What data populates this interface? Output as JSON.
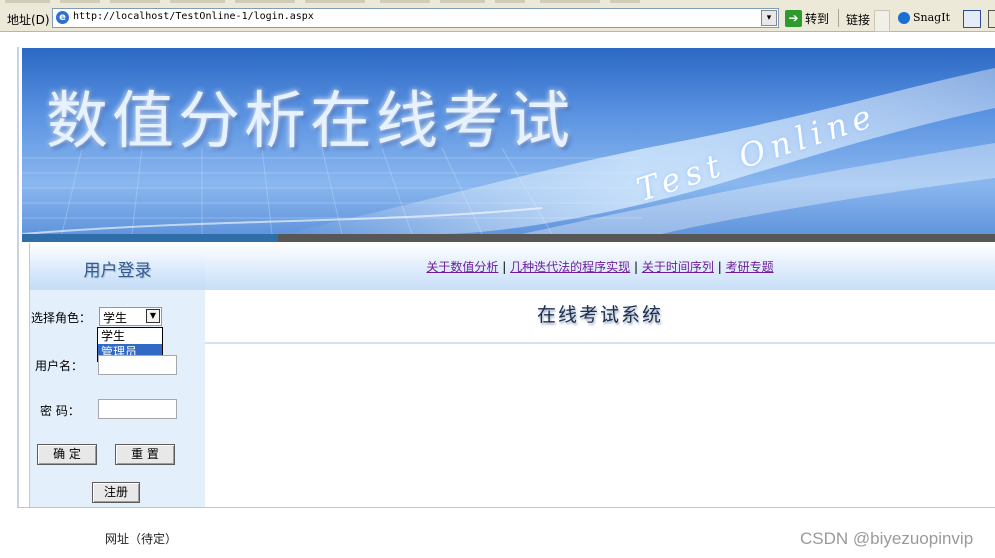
{
  "browser": {
    "address_label": "地址(D)",
    "url": "http://localhost/TestOnline-1/login.aspx",
    "go_label": "转到",
    "links_label": "链接",
    "snagit_label": "SnagIt"
  },
  "banner": {
    "title": "数值分析在线考试",
    "subtitle": "Test Online"
  },
  "login": {
    "header": "用户登录",
    "role_label": "选择角色：",
    "role_selected": "学生",
    "role_options": [
      "学生",
      "管理员"
    ],
    "username_label": "用户名：",
    "password_label": "密 码：",
    "confirm_button": "确 定",
    "reset_button": "重 置",
    "register_button": "注册"
  },
  "nav": {
    "links": [
      "关于数值分析",
      "几种迭代法的程序实现",
      "关于时间序列",
      "考研专题"
    ],
    "separator": "|"
  },
  "main": {
    "system_title": "在线考试系统"
  },
  "footer": {
    "text": "网址（待定）"
  },
  "watermark": "CSDN @biyezuopinvip"
}
